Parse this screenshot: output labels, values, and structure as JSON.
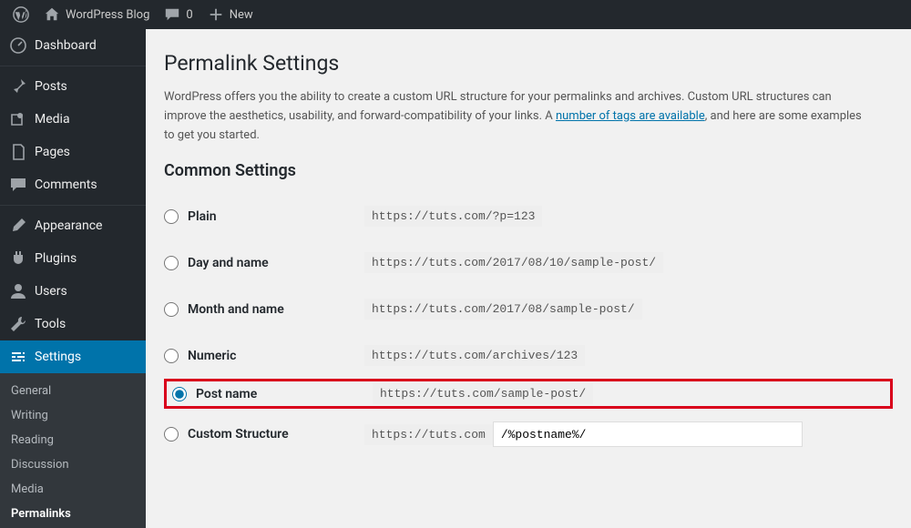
{
  "adminbar": {
    "site_name": "WordPress Blog",
    "comments_count": "0",
    "new_label": "New"
  },
  "sidebar": {
    "items": [
      {
        "label": "Dashboard"
      },
      {
        "label": "Posts"
      },
      {
        "label": "Media"
      },
      {
        "label": "Pages"
      },
      {
        "label": "Comments"
      },
      {
        "label": "Appearance"
      },
      {
        "label": "Plugins"
      },
      {
        "label": "Users"
      },
      {
        "label": "Tools"
      },
      {
        "label": "Settings"
      }
    ],
    "submenu": [
      {
        "label": "General"
      },
      {
        "label": "Writing"
      },
      {
        "label": "Reading"
      },
      {
        "label": "Discussion"
      },
      {
        "label": "Media"
      },
      {
        "label": "Permalinks"
      }
    ]
  },
  "page": {
    "title": "Permalink Settings",
    "desc_part1": "WordPress offers you the ability to create a custom URL structure for your permalinks and archives. Custom URL structures can improve the aesthetics, usability, and forward-compatibility of your links. A ",
    "desc_link": "number of tags are available",
    "desc_part2": ", and here are some examples to get you started.",
    "section_heading": "Common Settings",
    "options": [
      {
        "label": "Plain",
        "example": "https://tuts.com/?p=123"
      },
      {
        "label": "Day and name",
        "example": "https://tuts.com/2017/08/10/sample-post/"
      },
      {
        "label": "Month and name",
        "example": "https://tuts.com/2017/08/sample-post/"
      },
      {
        "label": "Numeric",
        "example": "https://tuts.com/archives/123"
      },
      {
        "label": "Post name",
        "example": "https://tuts.com/sample-post/"
      },
      {
        "label": "Custom Structure",
        "prefix": "https://tuts.com",
        "value": "/%postname%/"
      }
    ],
    "selected_index": 4
  }
}
